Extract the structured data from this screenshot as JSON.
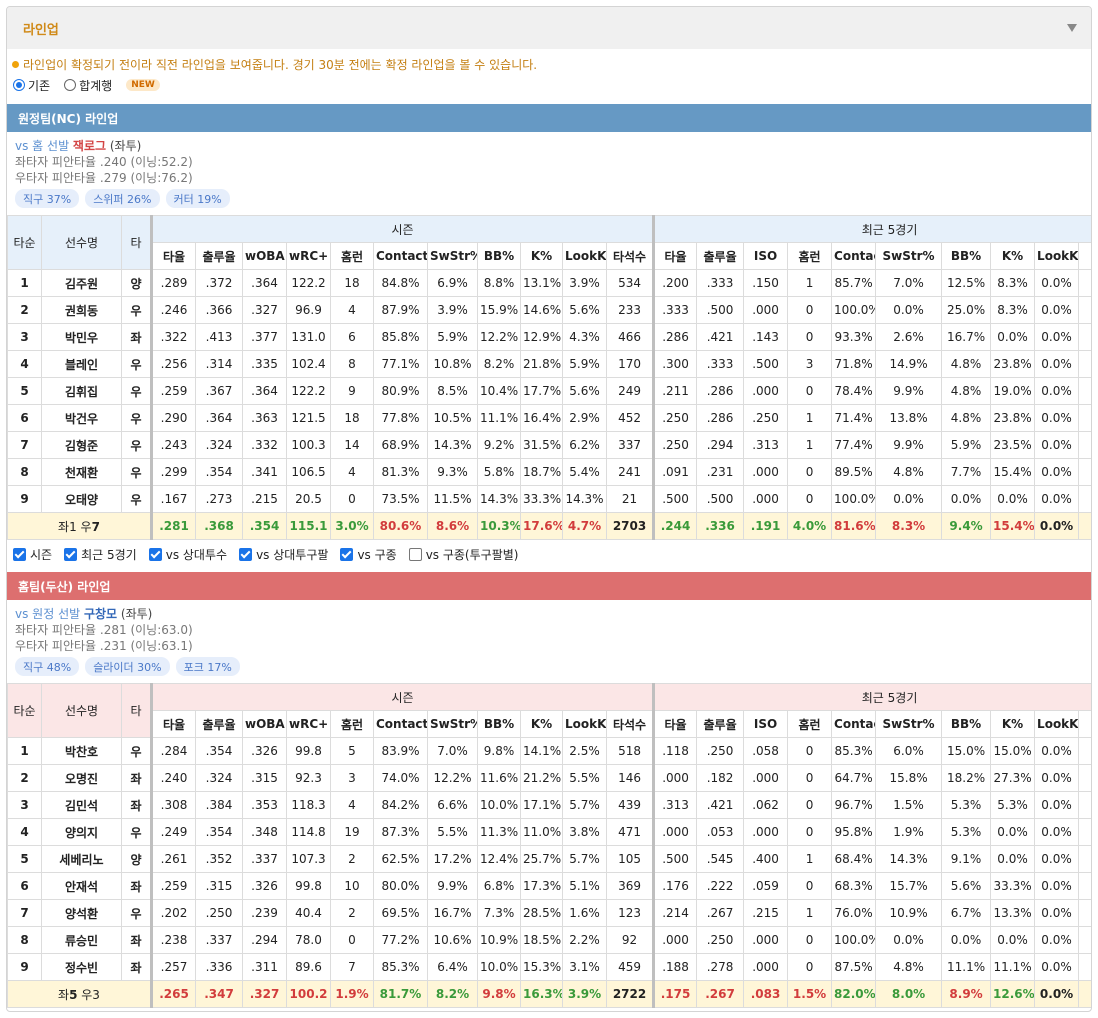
{
  "panel": {
    "title": "라인업"
  },
  "notice": "라인업이 확정되기 전이라 직전 라인업을 보여줍니다. 경기 30분 전에는 확정 라인업을 볼 수 있습니다.",
  "view_mode": {
    "options": [
      {
        "label": "기존",
        "selected": true
      },
      {
        "label": "합계행",
        "selected": false
      }
    ],
    "new_badge": "NEW"
  },
  "columns": {
    "order": "타순",
    "name": "선수명",
    "bat": "타",
    "season_group": "시즌",
    "recent_group": "최근 5경기",
    "season": [
      "타율",
      "출루율",
      "wOBA",
      "wRC+",
      "홈런",
      "Contact%",
      "SwStr%",
      "BB%",
      "K%",
      "LookK%",
      "타석수"
    ],
    "recent": [
      "타율",
      "출루율",
      "ISO",
      "홈런",
      "Contact%",
      "SwStr%",
      "BB%",
      "K%",
      "LookK%"
    ]
  },
  "away": {
    "bar": "원정팀(NC) 라인업",
    "pitcher_prefix": "vs 홈 선발 ",
    "pitcher_name": "잭로그",
    "pitcher_hand": " (좌투)",
    "vs_left": "좌타자 피안타율 .240 (이닝:52.2)",
    "vs_right": "우타자 피안타율 .279 (이닝:76.2)",
    "pitches": [
      "직구 37%",
      "스위퍼 26%",
      "커터 19%"
    ],
    "rows": [
      {
        "o": "1",
        "n": "김주원",
        "b": "양",
        "s": [
          ".289",
          ".372",
          ".364",
          "122.2",
          "18",
          "84.8%",
          "6.9%",
          "8.8%",
          "13.1%",
          "3.9%",
          "534"
        ],
        "r": [
          ".200",
          ".333",
          ".150",
          "1",
          "85.7%",
          "7.0%",
          "12.5%",
          "8.3%",
          "0.0%"
        ]
      },
      {
        "o": "2",
        "n": "권희동",
        "b": "우",
        "s": [
          ".246",
          ".366",
          ".327",
          "96.9",
          "4",
          "87.9%",
          "3.9%",
          "15.9%",
          "14.6%",
          "5.6%",
          "233"
        ],
        "r": [
          ".333",
          ".500",
          ".000",
          "0",
          "100.0%",
          "0.0%",
          "25.0%",
          "8.3%",
          "0.0%"
        ]
      },
      {
        "o": "3",
        "n": "박민우",
        "b": "좌",
        "s": [
          ".322",
          ".413",
          ".377",
          "131.0",
          "6",
          "85.8%",
          "5.9%",
          "12.2%",
          "12.9%",
          "4.3%",
          "466"
        ],
        "r": [
          ".286",
          ".421",
          ".143",
          "0",
          "93.3%",
          "2.6%",
          "16.7%",
          "0.0%",
          "0.0%"
        ]
      },
      {
        "o": "4",
        "n": "블레인",
        "b": "우",
        "s": [
          ".256",
          ".314",
          ".335",
          "102.4",
          "8",
          "77.1%",
          "10.8%",
          "8.2%",
          "21.8%",
          "5.9%",
          "170"
        ],
        "r": [
          ".300",
          ".333",
          ".500",
          "3",
          "71.8%",
          "14.9%",
          "4.8%",
          "23.8%",
          "0.0%"
        ]
      },
      {
        "o": "5",
        "n": "김휘집",
        "b": "우",
        "s": [
          ".259",
          ".367",
          ".364",
          "122.2",
          "9",
          "80.9%",
          "8.5%",
          "10.4%",
          "17.7%",
          "5.6%",
          "249"
        ],
        "r": [
          ".211",
          ".286",
          ".000",
          "0",
          "78.4%",
          "9.9%",
          "4.8%",
          "19.0%",
          "0.0%"
        ]
      },
      {
        "o": "6",
        "n": "박건우",
        "b": "우",
        "s": [
          ".290",
          ".364",
          ".363",
          "121.5",
          "18",
          "77.8%",
          "10.5%",
          "11.1%",
          "16.4%",
          "2.9%",
          "452"
        ],
        "r": [
          ".250",
          ".286",
          ".250",
          "1",
          "71.4%",
          "13.8%",
          "4.8%",
          "23.8%",
          "0.0%"
        ]
      },
      {
        "o": "7",
        "n": "김형준",
        "b": "우",
        "s": [
          ".243",
          ".324",
          ".332",
          "100.3",
          "14",
          "68.9%",
          "14.3%",
          "9.2%",
          "31.5%",
          "6.2%",
          "337"
        ],
        "r": [
          ".250",
          ".294",
          ".313",
          "1",
          "77.4%",
          "9.9%",
          "5.9%",
          "23.5%",
          "0.0%"
        ]
      },
      {
        "o": "8",
        "n": "천재환",
        "b": "우",
        "s": [
          ".299",
          ".354",
          ".341",
          "106.5",
          "4",
          "81.3%",
          "9.3%",
          "5.8%",
          "18.7%",
          "5.4%",
          "241"
        ],
        "r": [
          ".091",
          ".231",
          ".000",
          "0",
          "89.5%",
          "4.8%",
          "7.7%",
          "15.4%",
          "0.0%"
        ]
      },
      {
        "o": "9",
        "n": "오태양",
        "b": "우",
        "s": [
          ".167",
          ".273",
          ".215",
          "20.5",
          "0",
          "73.5%",
          "11.5%",
          "14.3%",
          "33.3%",
          "14.3%",
          "21"
        ],
        "r": [
          ".500",
          ".500",
          ".000",
          "0",
          "100.0%",
          "0.0%",
          "0.0%",
          "0.0%",
          "0.0%"
        ]
      }
    ],
    "summary": {
      "label_left": "좌1 우",
      "label_num": "7",
      "s": [
        ".281",
        ".368",
        ".354",
        "115.1",
        "3.0%",
        "80.6%",
        "8.6%",
        "10.3%",
        "17.6%",
        "4.7%",
        "2703"
      ],
      "s_colors": [
        "g",
        "g",
        "g",
        "g",
        "g",
        "r",
        "r",
        "g",
        "r",
        "r",
        "k"
      ],
      "r": [
        ".244",
        ".336",
        ".191",
        "4.0%",
        "81.6%",
        "8.3%",
        "9.4%",
        "15.4%",
        "0.0%"
      ],
      "r_colors": [
        "g",
        "g",
        "g",
        "g",
        "r",
        "r",
        "g",
        "r",
        "k"
      ]
    }
  },
  "filters": [
    {
      "label": "시즌",
      "checked": true
    },
    {
      "label": "최근 5경기",
      "checked": true
    },
    {
      "label": "vs 상대투수",
      "checked": true
    },
    {
      "label": "vs 상대투구팔",
      "checked": true
    },
    {
      "label": "vs 구종",
      "checked": true
    },
    {
      "label": "vs 구종(투구팔별)",
      "checked": false
    }
  ],
  "home": {
    "bar": "홈팀(두산) 라인업",
    "pitcher_prefix": "vs 원정 선발 ",
    "pitcher_name": "구창모",
    "pitcher_hand": " (좌투)",
    "vs_left": "좌타자 피안타율 .281 (이닝:63.0)",
    "vs_right": "우타자 피안타율 .231 (이닝:63.1)",
    "pitches": [
      "직구 48%",
      "슬라이더 30%",
      "포크 17%"
    ],
    "rows": [
      {
        "o": "1",
        "n": "박찬호",
        "b": "우",
        "s": [
          ".284",
          ".354",
          ".326",
          "99.8",
          "5",
          "83.9%",
          "7.0%",
          "9.8%",
          "14.1%",
          "2.5%",
          "518"
        ],
        "r": [
          ".118",
          ".250",
          ".058",
          "0",
          "85.3%",
          "6.0%",
          "15.0%",
          "15.0%",
          "0.0%"
        ]
      },
      {
        "o": "2",
        "n": "오명진",
        "b": "좌",
        "s": [
          ".240",
          ".324",
          ".315",
          "92.3",
          "3",
          "74.0%",
          "12.2%",
          "11.6%",
          "21.2%",
          "5.5%",
          "146"
        ],
        "r": [
          ".000",
          ".182",
          ".000",
          "0",
          "64.7%",
          "15.8%",
          "18.2%",
          "27.3%",
          "0.0%"
        ]
      },
      {
        "o": "3",
        "n": "김민석",
        "b": "좌",
        "s": [
          ".308",
          ".384",
          ".353",
          "118.3",
          "4",
          "84.2%",
          "6.6%",
          "10.0%",
          "17.1%",
          "5.7%",
          "439"
        ],
        "r": [
          ".313",
          ".421",
          ".062",
          "0",
          "96.7%",
          "1.5%",
          "5.3%",
          "5.3%",
          "0.0%"
        ]
      },
      {
        "o": "4",
        "n": "양의지",
        "b": "우",
        "s": [
          ".249",
          ".354",
          ".348",
          "114.8",
          "19",
          "87.3%",
          "5.5%",
          "11.3%",
          "11.0%",
          "3.8%",
          "471"
        ],
        "r": [
          ".000",
          ".053",
          ".000",
          "0",
          "95.8%",
          "1.9%",
          "5.3%",
          "0.0%",
          "0.0%"
        ]
      },
      {
        "o": "5",
        "n": "세베리노",
        "b": "양",
        "s": [
          ".261",
          ".352",
          ".337",
          "107.3",
          "2",
          "62.5%",
          "17.2%",
          "12.4%",
          "25.7%",
          "5.7%",
          "105"
        ],
        "r": [
          ".500",
          ".545",
          ".400",
          "1",
          "68.4%",
          "14.3%",
          "9.1%",
          "0.0%",
          "0.0%"
        ]
      },
      {
        "o": "6",
        "n": "안재석",
        "b": "좌",
        "s": [
          ".259",
          ".315",
          ".326",
          "99.8",
          "10",
          "80.0%",
          "9.9%",
          "6.8%",
          "17.3%",
          "5.1%",
          "369"
        ],
        "r": [
          ".176",
          ".222",
          ".059",
          "0",
          "68.3%",
          "15.7%",
          "5.6%",
          "33.3%",
          "0.0%"
        ]
      },
      {
        "o": "7",
        "n": "양석환",
        "b": "우",
        "s": [
          ".202",
          ".250",
          ".239",
          "40.4",
          "2",
          "69.5%",
          "16.7%",
          "7.3%",
          "28.5%",
          "1.6%",
          "123"
        ],
        "r": [
          ".214",
          ".267",
          ".215",
          "1",
          "76.0%",
          "10.9%",
          "6.7%",
          "13.3%",
          "0.0%"
        ]
      },
      {
        "o": "8",
        "n": "류승민",
        "b": "좌",
        "s": [
          ".238",
          ".337",
          ".294",
          "78.0",
          "0",
          "77.2%",
          "10.6%",
          "10.9%",
          "18.5%",
          "2.2%",
          "92"
        ],
        "r": [
          ".000",
          ".250",
          ".000",
          "0",
          "100.0%",
          "0.0%",
          "0.0%",
          "0.0%",
          "0.0%"
        ]
      },
      {
        "o": "9",
        "n": "정수빈",
        "b": "좌",
        "s": [
          ".257",
          ".336",
          ".311",
          "89.6",
          "7",
          "85.3%",
          "6.4%",
          "10.0%",
          "15.3%",
          "3.1%",
          "459"
        ],
        "r": [
          ".188",
          ".278",
          ".000",
          "0",
          "87.5%",
          "4.8%",
          "11.1%",
          "11.1%",
          "0.0%"
        ]
      }
    ],
    "summary": {
      "label_left": "좌",
      "label_num": "5",
      "label_right": " 우3",
      "s": [
        ".265",
        ".347",
        ".327",
        "100.2",
        "1.9%",
        "81.7%",
        "8.2%",
        "9.8%",
        "16.3%",
        "3.9%",
        "2722"
      ],
      "s_colors": [
        "r",
        "r",
        "r",
        "r",
        "r",
        "g",
        "g",
        "r",
        "g",
        "g",
        "k"
      ],
      "r": [
        ".175",
        ".267",
        ".083",
        "1.5%",
        "82.0%",
        "8.0%",
        "8.9%",
        "12.6%",
        "0.0%"
      ],
      "r_colors": [
        "r",
        "r",
        "r",
        "r",
        "g",
        "g",
        "r",
        "g",
        "k"
      ]
    }
  },
  "colors": {
    "away_bar": "#6699c4",
    "home_bar": "#dd6f6f",
    "title": "#d08a18",
    "good": "#3a9a3a",
    "bad": "#d23c3c"
  }
}
